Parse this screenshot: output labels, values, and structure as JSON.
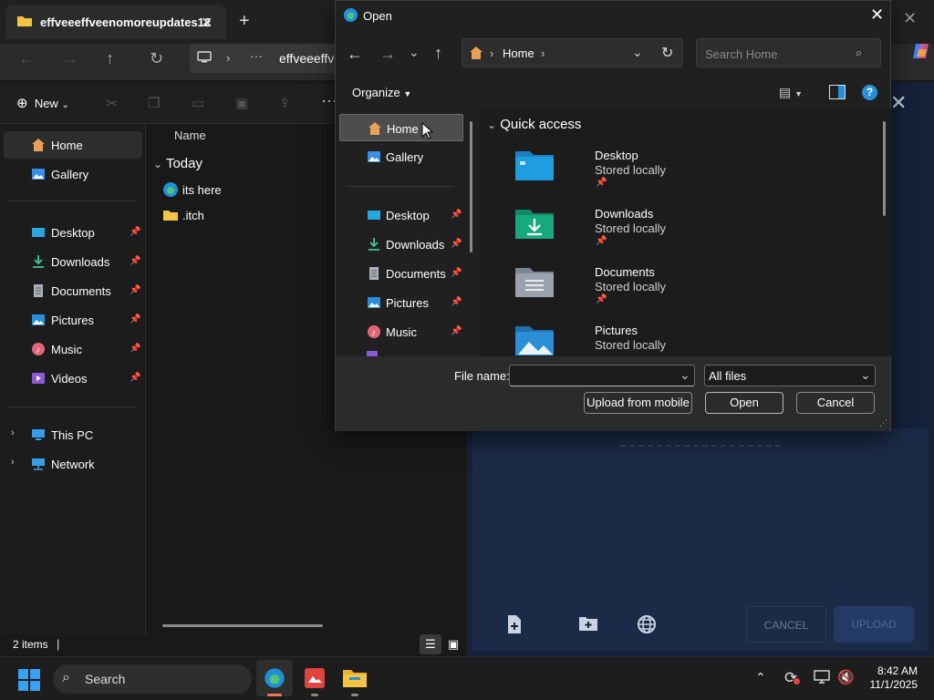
{
  "explorer": {
    "tab_title": "effveeeffveenomoreupdates12",
    "breadcrumb": "effveeeffv",
    "new_label": "New",
    "column_name": "Name",
    "group_today": "Today",
    "files": [
      {
        "name": "its here",
        "icon": "edge-file-icon"
      },
      {
        "name": ".itch",
        "icon": "folder-icon"
      }
    ],
    "sidebar": {
      "top": [
        {
          "label": "Home",
          "icon": "home-icon"
        },
        {
          "label": "Gallery",
          "icon": "gallery-icon"
        }
      ],
      "pinned": [
        {
          "label": "Desktop",
          "icon": "desktop-icon"
        },
        {
          "label": "Downloads",
          "icon": "downloads-icon"
        },
        {
          "label": "Documents",
          "icon": "documents-icon"
        },
        {
          "label": "Pictures",
          "icon": "pictures-icon"
        },
        {
          "label": "Music",
          "icon": "music-icon"
        },
        {
          "label": "Videos",
          "icon": "videos-icon"
        }
      ],
      "bottom": [
        {
          "label": "This PC",
          "icon": "pc-icon"
        },
        {
          "label": "Network",
          "icon": "network-icon"
        }
      ]
    },
    "status": "2 items"
  },
  "background_dialog": {
    "cancel_label": "CANCEL",
    "upload_label": "UPLOAD"
  },
  "open_dialog": {
    "title": "Open",
    "breadcrumb": "Home",
    "search_placeholder": "Search Home",
    "organize_label": "Organize",
    "sidebar": [
      {
        "label": "Home",
        "icon": "home-icon",
        "selected": true
      },
      {
        "label": "Gallery",
        "icon": "gallery-icon"
      },
      {
        "label": "Desktop",
        "icon": "desktop-icon",
        "pinned": true
      },
      {
        "label": "Downloads",
        "icon": "downloads-icon",
        "pinned": true
      },
      {
        "label": "Documents",
        "icon": "documents-icon",
        "pinned": true
      },
      {
        "label": "Pictures",
        "icon": "pictures-icon",
        "pinned": true
      },
      {
        "label": "Music",
        "icon": "music-icon",
        "pinned": true
      }
    ],
    "quick_access_title": "Quick access",
    "quick_access": [
      {
        "name": "Desktop",
        "sub": "Stored locally",
        "color": "#1e9de0"
      },
      {
        "name": "Downloads",
        "sub": "Stored locally",
        "color": "#17a97e"
      },
      {
        "name": "Documents",
        "sub": "Stored locally",
        "color": "#9aa3ad"
      },
      {
        "name": "Pictures",
        "sub": "Stored locally",
        "color": "#2a8fd6"
      }
    ],
    "file_name_label": "File name:",
    "file_name_value": "",
    "filter_value": "All files",
    "upload_mobile_label": "Upload from mobile",
    "open_label": "Open",
    "cancel_label": "Cancel"
  },
  "taskbar": {
    "search_label": "Search",
    "time": "8:42 AM",
    "date": "11/1/2025"
  }
}
